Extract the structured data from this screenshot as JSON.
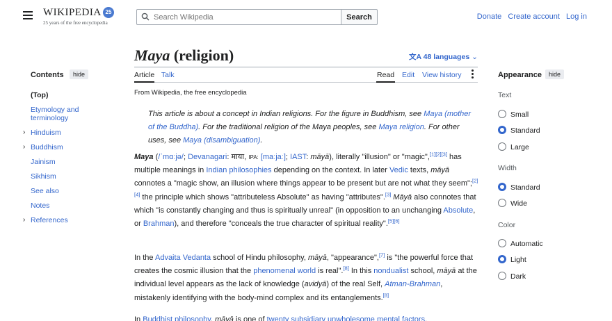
{
  "header": {
    "logo_word": "WIKIPEDIA",
    "logo_badge": "25",
    "tagline": "25 years of the free encyclopedia",
    "search_placeholder": "Search Wikipedia",
    "search_button": "Search",
    "links": [
      "Donate",
      "Create account",
      "Log in"
    ]
  },
  "toc": {
    "heading": "Contents",
    "hide_label": "hide",
    "items": [
      {
        "label": "(Top)",
        "chevron": false
      },
      {
        "label": "Etymology and terminology",
        "chevron": false
      },
      {
        "label": "Hinduism",
        "chevron": true
      },
      {
        "label": "Buddhism",
        "chevron": true
      },
      {
        "label": "Jainism",
        "chevron": false
      },
      {
        "label": "Sikhism",
        "chevron": false
      },
      {
        "label": "See also",
        "chevron": false
      },
      {
        "label": "Notes",
        "chevron": false
      },
      {
        "label": "References",
        "chevron": true
      }
    ]
  },
  "article": {
    "title_italic": "Maya",
    "title_rest": " (religion)",
    "languages": "48 languages",
    "tabs_left": [
      "Article",
      "Talk"
    ],
    "tabs_right": [
      "Read",
      "Edit",
      "View history"
    ],
    "from": "From Wikipedia, the free encyclopedia",
    "hatnote": {
      "t1": "This article is about a concept in Indian religions. For the figure in Buddhism, see ",
      "l1": "Maya (mother of the Buddha)",
      "t2": ". For the traditional religion of the Maya peoples, see ",
      "l2": "Maya religion",
      "t3": ". For other uses, see ",
      "l3": "Maya (disambiguation)",
      "t4": "."
    }
  },
  "appearance": {
    "heading": "Appearance",
    "hide_label": "hide",
    "text_label": "Text",
    "text_options": [
      "Small",
      "Standard",
      "Large"
    ],
    "text_selected": "Standard",
    "width_label": "Width",
    "width_options": [
      "Standard",
      "Wide"
    ],
    "width_selected": "Standard",
    "color_label": "Color",
    "color_options": [
      "Automatic",
      "Light",
      "Dark"
    ],
    "color_selected": "Light"
  },
  "colors": {
    "link": "#3366cc",
    "text": "#202122"
  }
}
